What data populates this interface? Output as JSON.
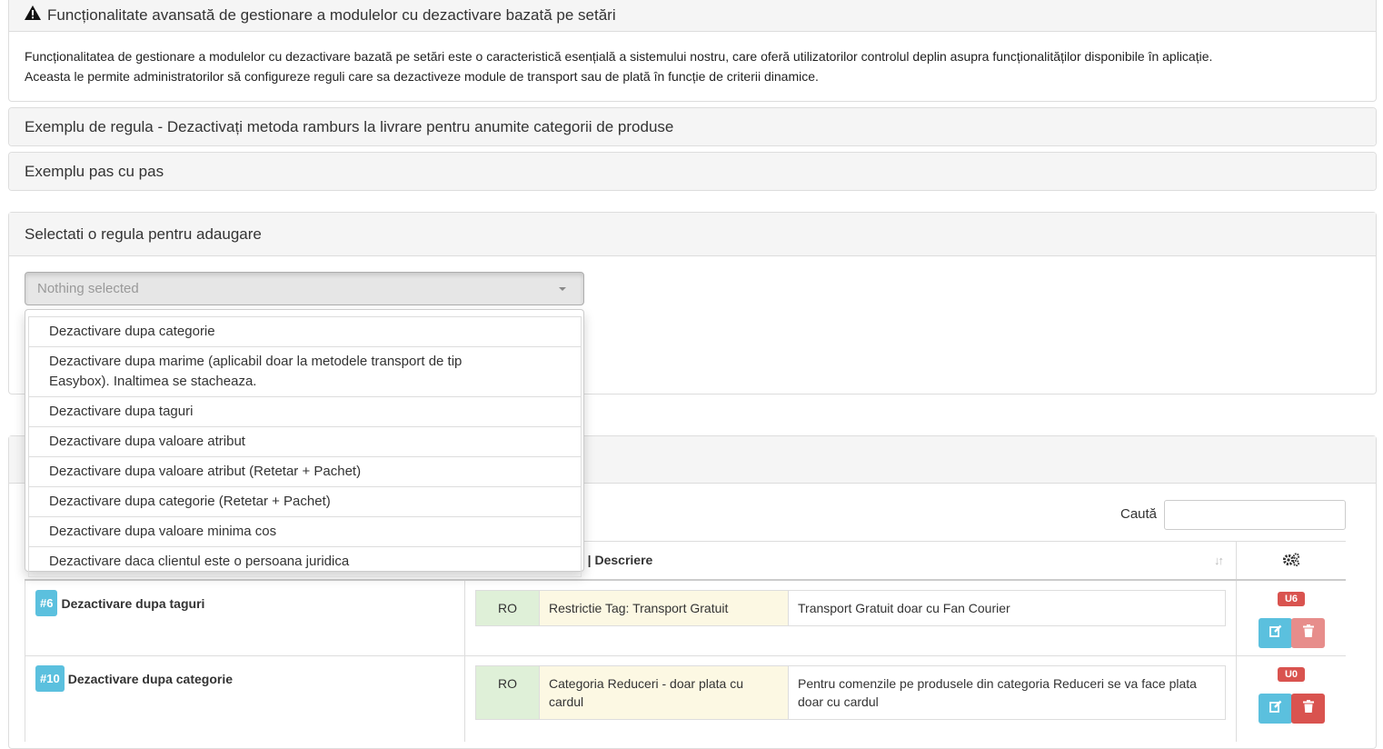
{
  "warning_panel": {
    "title": "Funcționalitate avansată de gestionare a modulelor cu dezactivare bazată pe setări",
    "icon": "warning-icon",
    "body_line1": "Funcționalitatea de gestionare a modulelor cu dezactivare bazată pe setări este o caracteristică esențială a sistemului nostru, care oferă utilizatorilor controlul deplin asupra funcționalităților disponibile în aplicație.",
    "body_line2": "Aceasta le permite administratorilor să configureze reguli care sa dezactiveze module de transport sau de plată în funcție de criterii dinamice."
  },
  "example_rule_panel": {
    "title": "Exemplu de regula - Dezactivați metoda ramburs la livrare pentru anumite categorii de produse"
  },
  "step_by_step_panel": {
    "title": "Exemplu pas cu pas"
  },
  "select_panel": {
    "title": "Selectati o regula pentru adaugare",
    "select_placeholder": "Nothing selected",
    "options": [
      "Dezactivare dupa categorie",
      "Dezactivare dupa marime (aplicabil doar la metodele transport de tip Easybox). Inaltimea se stacheaza.",
      "Dezactivare dupa taguri",
      "Dezactivare dupa valoare atribut",
      "Dezactivare dupa valoare atribut (Retetar + Pachet)",
      "Dezactivare dupa categorie (Retetar + Pachet)",
      "Dezactivare dupa valoare minima cos",
      "Dezactivare daca clientul este o persoana juridica"
    ]
  },
  "rules_table": {
    "search_label": "Caută",
    "search_value": "",
    "header_partial": "e | Descriere",
    "actions_icon": "gears-icon",
    "rows": [
      {
        "id": "#6",
        "name": "Dezactivare dupa taguri",
        "lang": "RO",
        "title": "Restrictie Tag: Transport Gratuit",
        "description": "Transport Gratuit doar cu Fan Courier",
        "usage_badge": "U6"
      },
      {
        "id": "#10",
        "name": "Dezactivare dupa categorie",
        "lang": "RO",
        "title": "Categoria Reduceri - doar plata cu cardul",
        "description": "Pentru comenzile pe produsele din categoria Reduceri se va face plata doar cu cardul",
        "usage_badge": "U0"
      }
    ]
  },
  "colors": {
    "info": "#5bc0de",
    "danger": "#d9534f",
    "success_bg": "#dff0d8",
    "warning_bg": "#fcf8e3",
    "panel_heading_bg": "#f5f5f5"
  }
}
